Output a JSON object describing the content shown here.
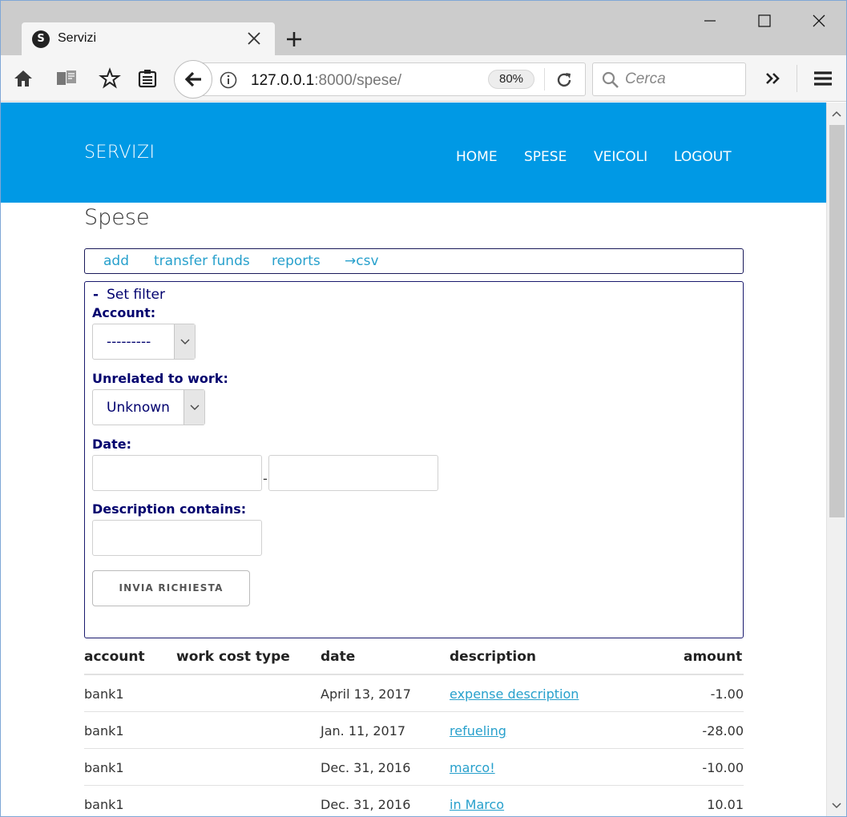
{
  "browser": {
    "tab_title": "Servizi",
    "tab_favicon_letter": "S",
    "url_host": "127.0.0.1",
    "url_rest": ":8000/spese/",
    "zoom": "80%",
    "search_placeholder": "Cerca"
  },
  "site": {
    "brand": "SERVIZI",
    "nav": [
      "HOME",
      "SPESE",
      "VEICOLI",
      "LOGOUT"
    ],
    "header_color": "#0099e5"
  },
  "page": {
    "title": "Spese",
    "actions": [
      "add",
      "transfer funds",
      "reports",
      "→csv"
    ]
  },
  "filter": {
    "toggle_symbol": "-",
    "toggle_label": "Set filter",
    "account_label": "Account:",
    "account_value": "---------",
    "unrelated_label": "Unrelated to work:",
    "unrelated_value": "Unknown",
    "date_label": "Date:",
    "date_separator": "-",
    "description_label": "Description contains:",
    "submit_label": "INVIA RICHIESTA"
  },
  "table": {
    "headers": [
      "account",
      "work cost type",
      "date",
      "description",
      "amount"
    ],
    "rows": [
      {
        "account": "bank1",
        "work_cost_type": "",
        "date": "April 13, 2017",
        "description": "expense description",
        "amount": "-1.00"
      },
      {
        "account": "bank1",
        "work_cost_type": "",
        "date": "Jan. 11, 2017",
        "description": "refueling",
        "amount": "-28.00"
      },
      {
        "account": "bank1",
        "work_cost_type": "",
        "date": "Dec. 31, 2016",
        "description": "marco!",
        "amount": "-10.00"
      },
      {
        "account": "bank1",
        "work_cost_type": "",
        "date": "Dec. 31, 2016",
        "description": "in Marco",
        "amount": "10.01"
      }
    ]
  }
}
